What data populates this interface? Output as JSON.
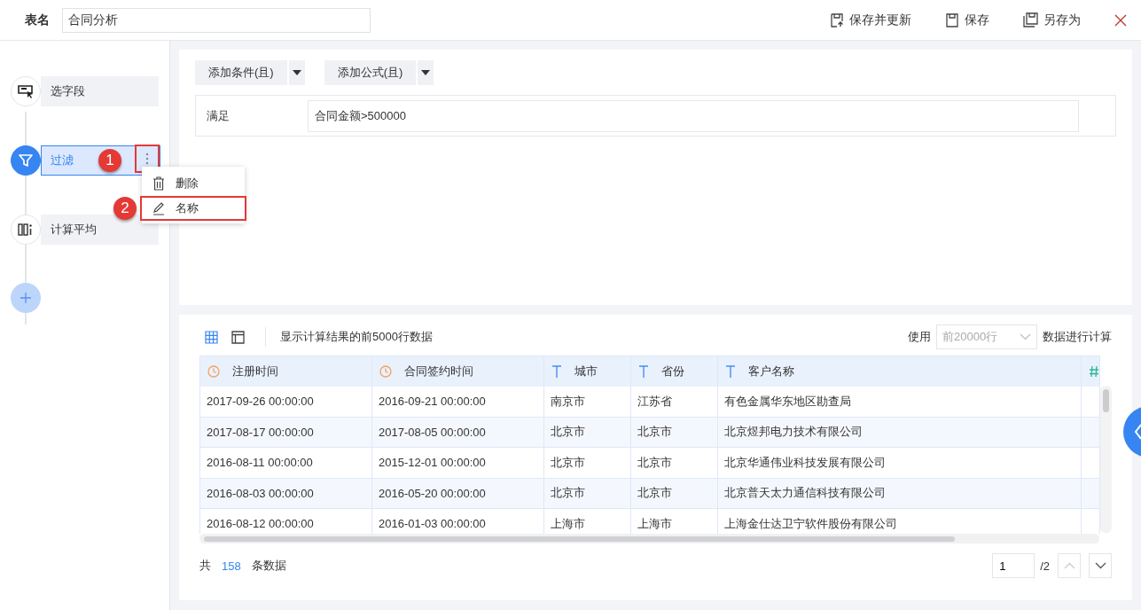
{
  "header": {
    "label": "表名",
    "table_name": "合同分析",
    "actions": [
      {
        "kind": "save_update",
        "label": "保存并更新"
      },
      {
        "kind": "save",
        "label": "保存"
      },
      {
        "kind": "save_as",
        "label": "另存为"
      }
    ]
  },
  "steps": [
    {
      "kind": "select",
      "label": "选字段",
      "selected": false
    },
    {
      "kind": "filter",
      "label": "过滤",
      "selected": true,
      "callout": "1"
    },
    {
      "kind": "average",
      "label": "计算平均",
      "selected": false
    }
  ],
  "context_menu": {
    "items": [
      {
        "kind": "delete",
        "label": "删除",
        "highlighted": false
      },
      {
        "kind": "rename",
        "label": "名称",
        "highlighted": true,
        "callout": "2"
      }
    ]
  },
  "filter": {
    "buttons": [
      "添加条件(且)",
      "添加公式(且)"
    ],
    "condition_label": "满足",
    "condition": "合同金额>500000"
  },
  "preview": {
    "views": [
      {
        "kind": "grid",
        "selected": true
      },
      {
        "kind": "panel",
        "selected": false
      }
    ],
    "note": "显示计算结果的前5000行数据",
    "use_label": "使用",
    "row_limit": "前20000行",
    "use_suffix": "数据进行计算",
    "table": {
      "columns": [
        {
          "kind": "date",
          "label": "注册时间"
        },
        {
          "kind": "date",
          "label": "合同签约时间"
        },
        {
          "kind": "text",
          "label": "城市"
        },
        {
          "kind": "text",
          "label": "省份"
        },
        {
          "kind": "text",
          "label": "客户名称"
        },
        {
          "kind": "number"
        }
      ],
      "rows": [
        [
          "2017-09-26 00:00:00",
          "2016-09-21 00:00:00",
          "南京市",
          "江苏省",
          "有色金属华东地区勘查局"
        ],
        [
          "2017-08-17 00:00:00",
          "2017-08-05 00:00:00",
          "北京市",
          "北京市",
          "北京煜邦电力技术有限公司"
        ],
        [
          "2016-08-11 00:00:00",
          "2015-12-01 00:00:00",
          "北京市",
          "北京市",
          "北京华通伟业科技发展有限公司"
        ],
        [
          "2016-08-03 00:00:00",
          "2016-05-20 00:00:00",
          "北京市",
          "北京市",
          "北京普天太力通信科技有限公司"
        ],
        [
          "2016-08-12 00:00:00",
          "2016-01-03 00:00:00",
          "上海市",
          "上海市",
          "上海金仕达卫宁软件股份有限公司"
        ]
      ]
    },
    "footer": {
      "prefix": "共",
      "count": "158",
      "suffix": "条数据",
      "page": "1",
      "pages": "/2"
    }
  }
}
